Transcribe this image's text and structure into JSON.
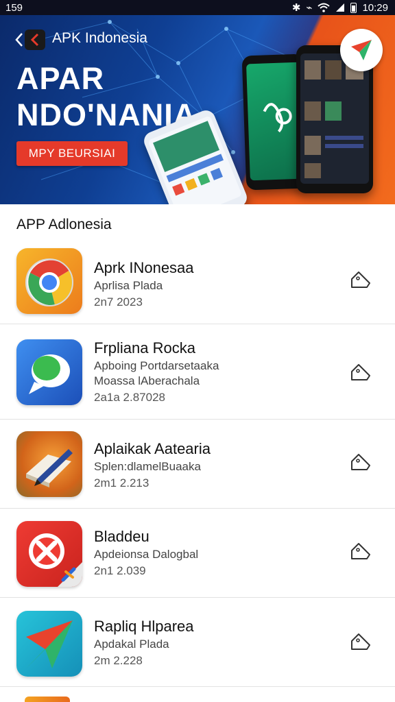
{
  "status_bar": {
    "left_text": "159",
    "time": "10:29",
    "icons": [
      "bluetooth-icon",
      "vibrate-icon",
      "wifi-icon",
      "signal-icon",
      "battery-icon"
    ]
  },
  "hero": {
    "app_name": "APK Indonesia",
    "title_line1": "APAR",
    "title_line2": "NDO'NANIA",
    "cta_label": "MPY BEURSIAI",
    "colors": {
      "blue": "#0f3f93",
      "orange": "#f26b1d",
      "cta": "#e53a2a"
    }
  },
  "section": {
    "title": "APP Adlonesia"
  },
  "apps": [
    {
      "name": "Aprk INonesaa",
      "subtitle": "Aprlisa Plada",
      "date": "2n7 2023",
      "icon": "chrome-icon"
    },
    {
      "name": "Frpliana Rocka",
      "subtitle": "Apboing Portdarsetaaka",
      "subtitle2": "Moassa lAberachala",
      "date": "2a1a 2.87028",
      "icon": "chat-bubble-icon"
    },
    {
      "name": "Aplaikak Aatearia",
      "subtitle": "Splen:dlamelBuaaka",
      "date": "2m1 2.213",
      "icon": "pen-book-icon"
    },
    {
      "name": "Bladdeu",
      "subtitle": "Apdeionsa Dalogbal",
      "date": "2n1 2.039",
      "icon": "block-x-icon"
    },
    {
      "name": "Rapliq Hlparea",
      "subtitle": "Apdakal Plada",
      "date": "2m 2.228",
      "icon": "paper-plane-icon"
    }
  ]
}
